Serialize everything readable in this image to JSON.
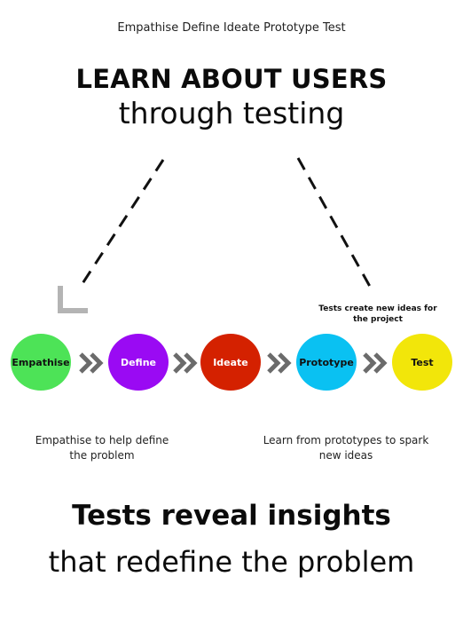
{
  "header": {
    "top_title": "Empathise Define Ideate Prototype Test",
    "headline": "LEARN ABOUT USERS",
    "subheadline": "through testing"
  },
  "stages": [
    {
      "label": "Empathise",
      "color": "#4de357",
      "text_color": "#111111"
    },
    {
      "label": "Define",
      "color": "#9a0af3",
      "text_color": "#ffffff"
    },
    {
      "label": "Ideate",
      "color": "#d42100",
      "text_color": "#ffffff"
    },
    {
      "label": "Prototype",
      "color": "#0ac1f2",
      "text_color": "#111111"
    },
    {
      "label": "Test",
      "color": "#f2e60a",
      "text_color": "#111111"
    }
  ],
  "notes": {
    "test_note": "Tests create new ideas for the project",
    "left_caption": "Empathise to help define the problem",
    "right_caption": "Learn from prototypes to spark new ideas"
  },
  "footer": {
    "title": "Tests reveal insights",
    "subtitle": "that redefine the problem"
  },
  "icons": {
    "stage_separator": "double-chevron-right-icon",
    "arrow_head": "arrow-head-icon"
  },
  "colors": {
    "chevron": "#6b6b6b",
    "arrow_head": "#b4b4b4",
    "dashed_line": "#111111"
  }
}
